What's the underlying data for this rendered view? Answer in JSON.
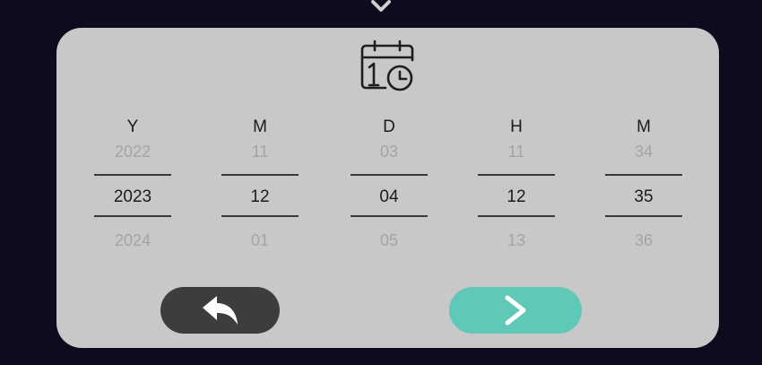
{
  "colors": {
    "background": "#0e0b1f",
    "panel": "#c8c8c8",
    "back_button": "#3d3d3d",
    "next_button": "#5fc8b6",
    "selected_text": "#1b1b1b",
    "adjacent_text": "#a4a4a4"
  },
  "header": {
    "icon": "calendar-clock-icon"
  },
  "columns": [
    {
      "header": "Y",
      "prev": "2022",
      "current": "2023",
      "next": "2024"
    },
    {
      "header": "M",
      "prev": "11",
      "current": "12",
      "next": "01"
    },
    {
      "header": "D",
      "prev": "03",
      "current": "04",
      "next": "05"
    },
    {
      "header": "H",
      "prev": "11",
      "current": "12",
      "next": "13"
    },
    {
      "header": "M",
      "prev": "34",
      "current": "35",
      "next": "36"
    }
  ],
  "buttons": {
    "back_icon": "undo-arrow-icon",
    "next_icon": "chevron-right-icon"
  },
  "top_indicator_icon": "chevron-down-icon"
}
